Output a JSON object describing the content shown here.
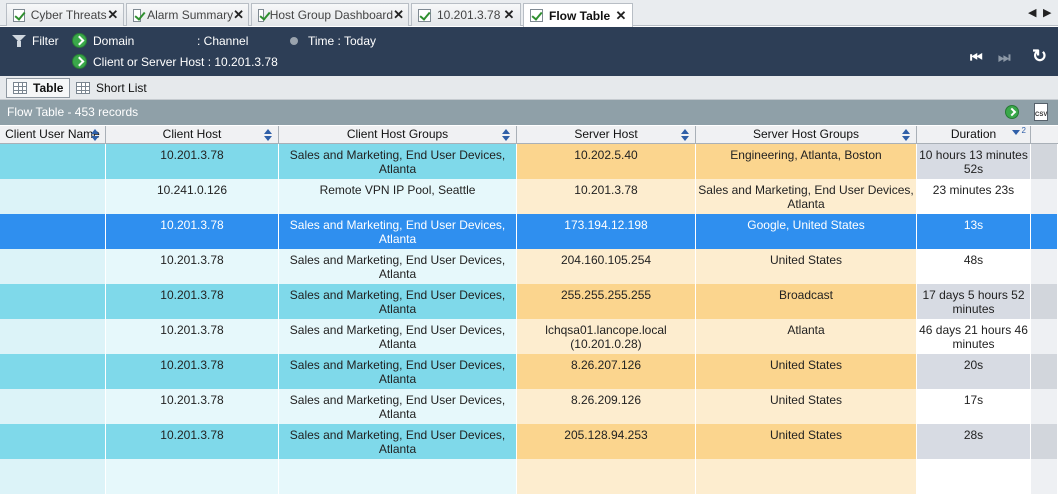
{
  "tabs": [
    {
      "label": "Cyber Threats",
      "active": false
    },
    {
      "label": "Alarm Summary",
      "active": false
    },
    {
      "label": "Host Group Dashboard",
      "active": false
    },
    {
      "label": "10.201.3.78",
      "active": false
    },
    {
      "label": "Flow Table",
      "active": true
    }
  ],
  "tab_nav": {
    "prev": "◀",
    "next": "▶"
  },
  "filter_bar": {
    "filter_label": "Filter",
    "domain_label": "Domain",
    "channel_text": ": Channel",
    "time_text": "Time : Today",
    "host_text": "Client or Server Host : 10.201.3.78",
    "rewind_icon": "⏮",
    "forward_icon": "⏭",
    "refresh_icon": "↻"
  },
  "views": {
    "table_label": "Table",
    "shortlist_label": "Short List"
  },
  "table_title": "Flow Table - 453 records",
  "columns": [
    {
      "label": "Client User Name"
    },
    {
      "label": "Client Host"
    },
    {
      "label": "Client Host Groups"
    },
    {
      "label": "Server Host"
    },
    {
      "label": "Server Host Groups"
    },
    {
      "label": "Duration",
      "sort_index": "2"
    }
  ],
  "rows": [
    {
      "client_user": "",
      "client_host": "10.201.3.78",
      "client_groups": "Sales and Marketing, End User Devices, Atlanta",
      "server_host": "10.202.5.40",
      "server_groups": "Engineering, Atlanta, Boston",
      "duration": "10 hours 13 minutes 52s",
      "style": "alt"
    },
    {
      "client_user": "",
      "client_host": "10.241.0.126",
      "client_groups": "Remote VPN IP Pool, Seattle",
      "server_host": "10.201.3.78",
      "server_groups": "Sales and Marketing, End User Devices, Atlanta",
      "duration": "23 minutes 23s",
      "style": "plain"
    },
    {
      "client_user": "",
      "client_host": "10.201.3.78",
      "client_groups": "Sales and Marketing, End User Devices, Atlanta",
      "server_host": "173.194.12.198",
      "server_groups": "Google, United States",
      "duration": "13s",
      "style": "sel"
    },
    {
      "client_user": "",
      "client_host": "10.201.3.78",
      "client_groups": "Sales and Marketing, End User Devices, Atlanta",
      "server_host": "204.160.105.254",
      "server_groups": "United States",
      "duration": "48s",
      "style": "plain"
    },
    {
      "client_user": "",
      "client_host": "10.201.3.78",
      "client_groups": "Sales and Marketing, End User Devices, Atlanta",
      "server_host": "255.255.255.255",
      "server_groups": "Broadcast",
      "duration": "17 days 5 hours 52 minutes",
      "style": "alt"
    },
    {
      "client_user": "",
      "client_host": "10.201.3.78",
      "client_groups": "Sales and Marketing, End User Devices, Atlanta",
      "server_host": "lchqsa01.lancope.local (10.201.0.28)",
      "server_groups": "Atlanta",
      "duration": "46 days 21 hours 46 minutes",
      "style": "plain"
    },
    {
      "client_user": "",
      "client_host": "10.201.3.78",
      "client_groups": "Sales and Marketing, End User Devices, Atlanta",
      "server_host": "8.26.207.126",
      "server_groups": "United States",
      "duration": "20s",
      "style": "alt"
    },
    {
      "client_user": "",
      "client_host": "10.201.3.78",
      "client_groups": "Sales and Marketing, End User Devices, Atlanta",
      "server_host": "8.26.209.126",
      "server_groups": "United States",
      "duration": "17s",
      "style": "plain"
    },
    {
      "client_user": "",
      "client_host": "10.201.3.78",
      "client_groups": "Sales and Marketing, End User Devices, Atlanta",
      "server_host": "205.128.94.253",
      "server_groups": "United States",
      "duration": "28s",
      "style": "alt"
    },
    {
      "client_user": "",
      "client_host": "",
      "client_groups": "",
      "server_host": "",
      "server_groups": "",
      "duration": "",
      "style": "plain"
    }
  ]
}
